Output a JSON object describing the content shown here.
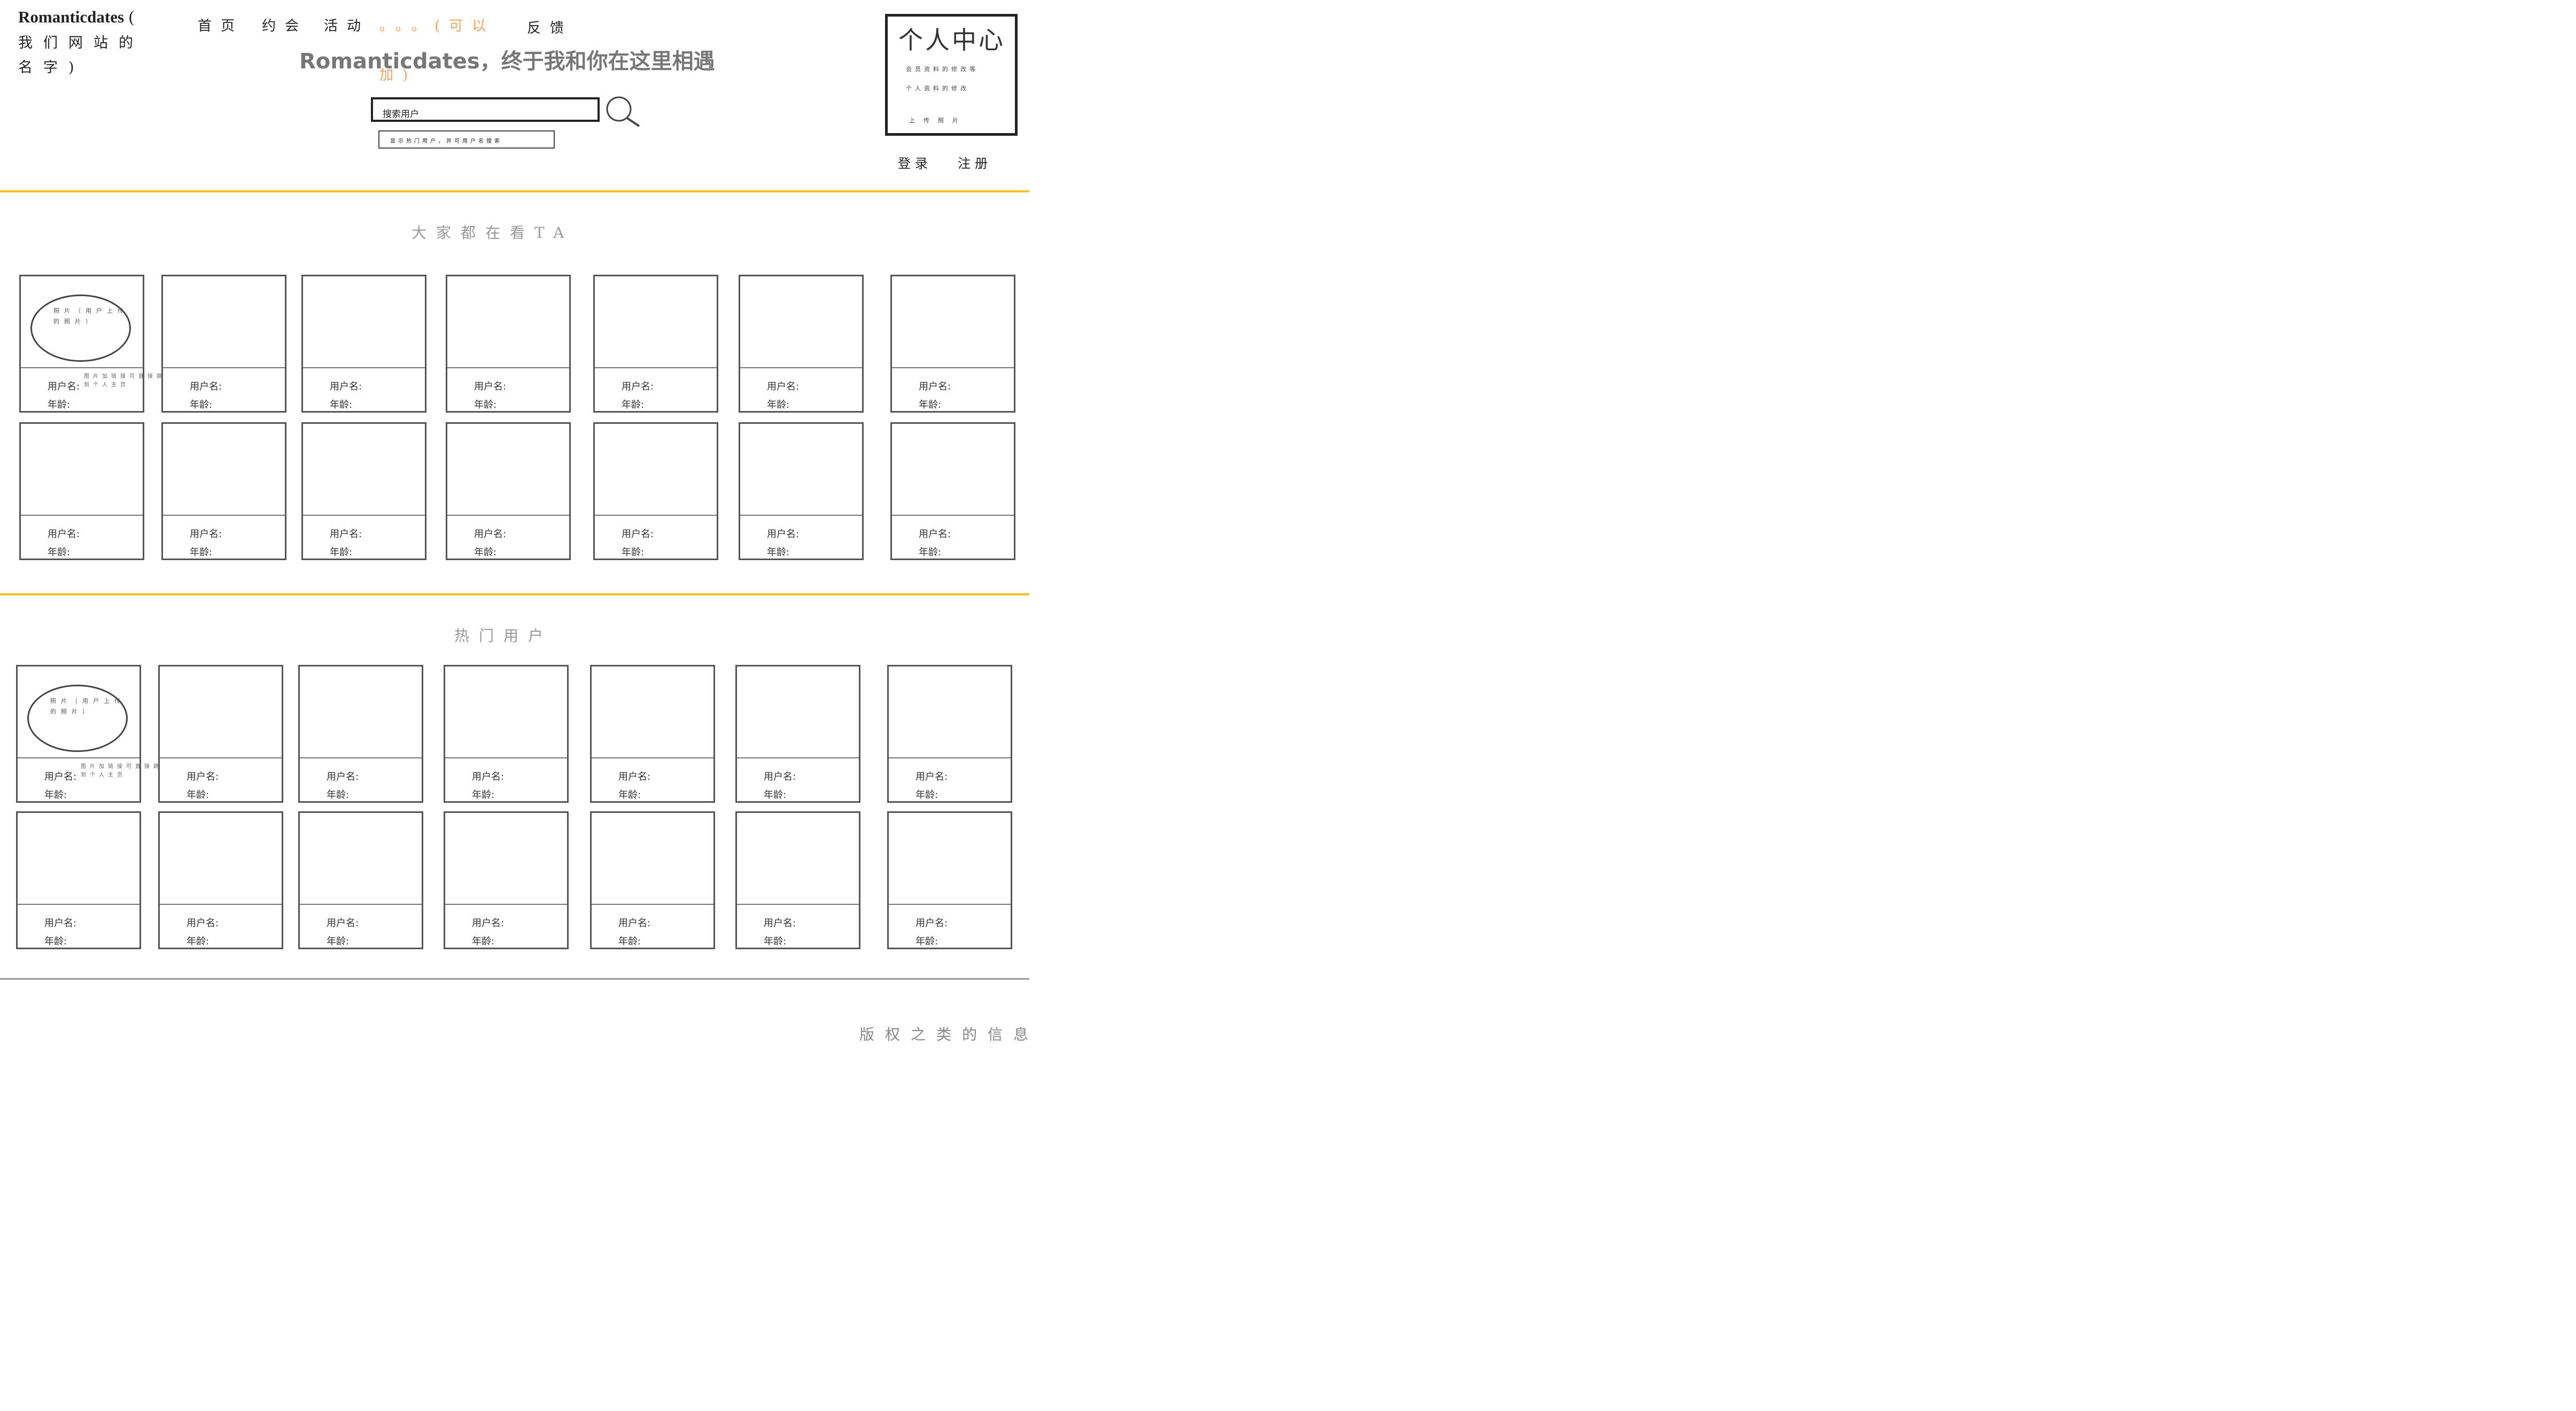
{
  "header": {
    "brand": "Romanticdates",
    "brand_paren": "(",
    "brand_sub": "我们网站的名字)",
    "nav": [
      {
        "label": "首页"
      },
      {
        "label": "约会"
      },
      {
        "label": "活动"
      }
    ],
    "nav_orange_1": "。。。(可以",
    "nav_orange_2": "加)",
    "feedback": "反馈",
    "slogan": "Romanticdates，终于我和你在这里相遇",
    "search": {
      "placeholder": "搜索用户",
      "hint": "显示热门用户，并可用户名搜索"
    },
    "profile": {
      "handwriting": "个人中心",
      "line1": "会员资料的修改等",
      "line2": "个人资料的修改",
      "line3": "上传照片"
    },
    "login": "登录",
    "register": "注册"
  },
  "sections": [
    {
      "title": "大家都在看TA",
      "card_note": "图片加链接可直接跳转到个人主页",
      "oval_text": "照片（用户上传的照片）",
      "rows": 2,
      "cols": 7
    },
    {
      "title": "热门用户",
      "card_note": "图片加链接可直接跳转到个人主页",
      "oval_text": "照片（用户上传的照片）",
      "rows": 2,
      "cols": 7
    }
  ],
  "card_labels": {
    "username": "用户名:",
    "age": "年龄:"
  },
  "footer": {
    "text": "版权之类的信息"
  },
  "colors": {
    "accent": "#f2c12e",
    "orange": "#f0a060"
  }
}
